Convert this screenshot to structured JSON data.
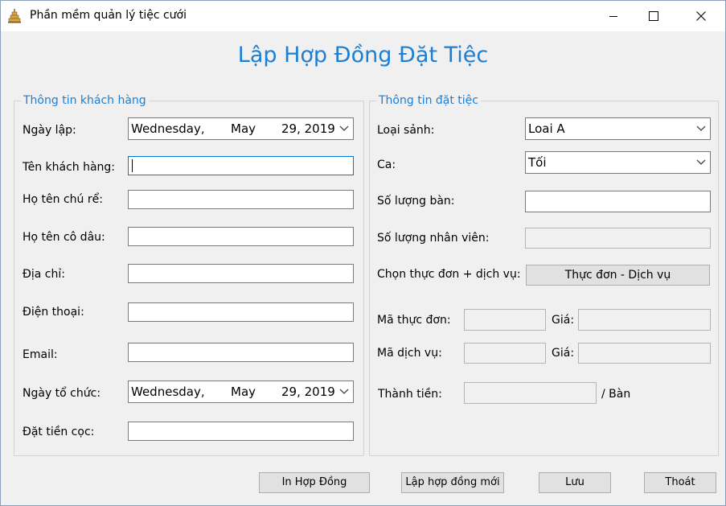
{
  "window": {
    "title": "Phần mềm quản lý tiệc cưới",
    "icons": {
      "app": "wedding-cake-icon",
      "minimize": "minimize-icon",
      "maximize": "maximize-icon",
      "close": "close-icon"
    }
  },
  "form_title": "Lập Hợp Đồng Đặt Tiệc",
  "customer": {
    "legend": "Thông tin khách hàng",
    "ngay_lap_label": "Ngày lập:",
    "ngay_lap": {
      "weekday": "Wednesday,",
      "month": "May",
      "day_year": "29, 2019"
    },
    "ten_khach_hang_label": "Tên khách hàng:",
    "ten_khach_hang_value": "",
    "chu_re_label": "Họ tên chú rể:",
    "chu_re_value": "",
    "co_dau_label": "Họ tên cô dâu:",
    "co_dau_value": "",
    "dia_chi_label": "Địa chỉ:",
    "dia_chi_value": "",
    "dien_thoai_label": "Điện thoại:",
    "dien_thoai_value": "",
    "email_label": "Email:",
    "email_value": "",
    "ngay_to_chuc_label": "Ngày tổ chức:",
    "ngay_to_chuc": {
      "weekday": "Wednesday,",
      "month": "May",
      "day_year": "29, 2019"
    },
    "dat_tien_coc_label": "Đặt tiền cọc:",
    "dat_tien_coc_value": ""
  },
  "booking": {
    "legend": "Thông tin đặt tiệc",
    "loai_sanh_label": "Loại sảnh:",
    "loai_sanh_value": "Loai A",
    "ca_label": "Ca:",
    "ca_value": "Tối",
    "so_luong_ban_label": "Số lượng bàn:",
    "so_luong_ban_value": "",
    "so_luong_nv_label": "Số lượng nhân viên:",
    "so_luong_nv_value": "",
    "chon_thuc_don_label": "Chọn thực đơn + dịch vụ:",
    "thuc_don_button": "Thực đơn - Dịch vụ",
    "ma_thuc_don_label": "Mã thực đơn:",
    "ma_thuc_don_value": "",
    "gia_td_label": "Giá:",
    "gia_td_value": "",
    "ma_dich_vu_label": "Mã dịch vụ:",
    "ma_dich_vu_value": "",
    "gia_dv_label": "Giá:",
    "gia_dv_value": "",
    "thanh_tien_label": "Thành tiền:",
    "thanh_tien_value": "",
    "per_table_label": "/ Bàn"
  },
  "actions": {
    "print": "In Hợp Đồng",
    "new": "Lập hợp đồng mới",
    "save": "Lưu",
    "exit": "Thoát"
  }
}
